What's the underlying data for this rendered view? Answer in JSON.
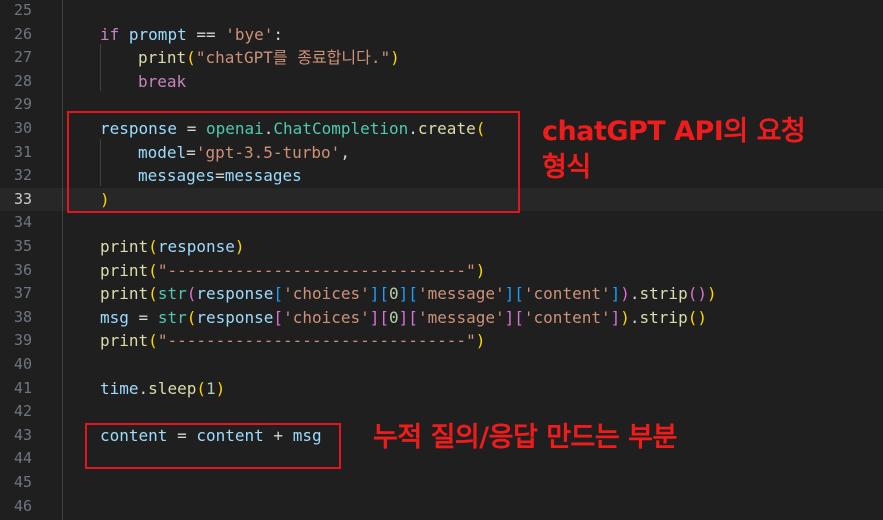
{
  "editor": {
    "lines": [
      {
        "n": "25",
        "tokens": []
      },
      {
        "n": "26",
        "tokens": [
          [
            "kw",
            "if"
          ],
          [
            "op",
            " "
          ],
          [
            "var",
            "prompt"
          ],
          [
            "op",
            " == "
          ],
          [
            "str",
            "'bye'"
          ],
          [
            "op",
            ":"
          ]
        ]
      },
      {
        "n": "27",
        "tokens": [
          [
            "fn",
            "print"
          ],
          [
            "p1",
            "("
          ],
          [
            "str",
            "\"chatGPT를 종료합니다.\""
          ],
          [
            "p1",
            ")"
          ]
        ]
      },
      {
        "n": "28",
        "tokens": [
          [
            "kw",
            "break"
          ]
        ]
      },
      {
        "n": "29",
        "tokens": []
      },
      {
        "n": "30",
        "tokens": [
          [
            "var",
            "response"
          ],
          [
            "op",
            " = "
          ],
          [
            "mod",
            "openai"
          ],
          [
            "op",
            "."
          ],
          [
            "cls",
            "ChatCompletion"
          ],
          [
            "op",
            "."
          ],
          [
            "fn",
            "create"
          ],
          [
            "p1",
            "("
          ]
        ]
      },
      {
        "n": "31",
        "tokens": [
          [
            "var",
            "model"
          ],
          [
            "op",
            "="
          ],
          [
            "str",
            "'gpt-3.5-turbo'"
          ],
          [
            "op",
            ","
          ]
        ]
      },
      {
        "n": "32",
        "tokens": [
          [
            "var",
            "messages"
          ],
          [
            "op",
            "="
          ],
          [
            "var",
            "messages"
          ]
        ]
      },
      {
        "n": "33",
        "tokens": [
          [
            "p1",
            ")"
          ]
        ]
      },
      {
        "n": "34",
        "tokens": []
      },
      {
        "n": "35",
        "tokens": [
          [
            "fn",
            "print"
          ],
          [
            "p1",
            "("
          ],
          [
            "var",
            "response"
          ],
          [
            "p1",
            ")"
          ]
        ]
      },
      {
        "n": "36",
        "tokens": [
          [
            "fn",
            "print"
          ],
          [
            "p1",
            "("
          ],
          [
            "str",
            "\"-------------------------------\""
          ],
          [
            "p1",
            ")"
          ]
        ]
      },
      {
        "n": "37",
        "tokens": [
          [
            "fn",
            "print"
          ],
          [
            "p1",
            "("
          ],
          [
            "cls",
            "str"
          ],
          [
            "p2",
            "("
          ],
          [
            "var",
            "response"
          ],
          [
            "p3",
            "["
          ],
          [
            "str",
            "'choices'"
          ],
          [
            "p3",
            "]["
          ],
          [
            "num",
            "0"
          ],
          [
            "p3",
            "]["
          ],
          [
            "str",
            "'message'"
          ],
          [
            "p3",
            "]["
          ],
          [
            "str",
            "'content'"
          ],
          [
            "p3",
            "]"
          ],
          [
            "p2",
            ")"
          ],
          [
            "op",
            "."
          ],
          [
            "fn",
            "strip"
          ],
          [
            "p2",
            "()"
          ],
          [
            "p1",
            ")"
          ]
        ]
      },
      {
        "n": "38",
        "tokens": [
          [
            "var",
            "msg"
          ],
          [
            "op",
            " = "
          ],
          [
            "cls",
            "str"
          ],
          [
            "p1",
            "("
          ],
          [
            "var",
            "response"
          ],
          [
            "p2",
            "["
          ],
          [
            "str",
            "'choices'"
          ],
          [
            "p2",
            "]["
          ],
          [
            "num",
            "0"
          ],
          [
            "p2",
            "]["
          ],
          [
            "str",
            "'message'"
          ],
          [
            "p2",
            "]["
          ],
          [
            "str",
            "'content'"
          ],
          [
            "p2",
            "]"
          ],
          [
            "p1",
            ")"
          ],
          [
            "op",
            "."
          ],
          [
            "fn",
            "strip"
          ],
          [
            "p1",
            "()"
          ]
        ]
      },
      {
        "n": "39",
        "tokens": [
          [
            "fn",
            "print"
          ],
          [
            "p1",
            "("
          ],
          [
            "str",
            "\"-------------------------------\""
          ],
          [
            "p1",
            ")"
          ]
        ]
      },
      {
        "n": "40",
        "tokens": []
      },
      {
        "n": "41",
        "tokens": [
          [
            "var",
            "time"
          ],
          [
            "op",
            "."
          ],
          [
            "fn",
            "sleep"
          ],
          [
            "p1",
            "("
          ],
          [
            "num",
            "1"
          ],
          [
            "p1",
            ")"
          ]
        ]
      },
      {
        "n": "42",
        "tokens": []
      },
      {
        "n": "43",
        "tokens": [
          [
            "var",
            "content"
          ],
          [
            "op",
            " = "
          ],
          [
            "var",
            "content"
          ],
          [
            "op",
            " + "
          ],
          [
            "var",
            "msg"
          ]
        ]
      },
      {
        "n": "44",
        "tokens": []
      },
      {
        "n": "45",
        "tokens": []
      },
      {
        "n": "46",
        "tokens": []
      }
    ],
    "active_line": "33"
  },
  "annotations": {
    "api_line1": "chatGPT API의 요청",
    "api_line2": "형식",
    "accumulate": "누적 질의/응답 만드는 부분"
  },
  "colors": {
    "background": "#1f1f1f",
    "annotation_red": "#e3161d"
  }
}
